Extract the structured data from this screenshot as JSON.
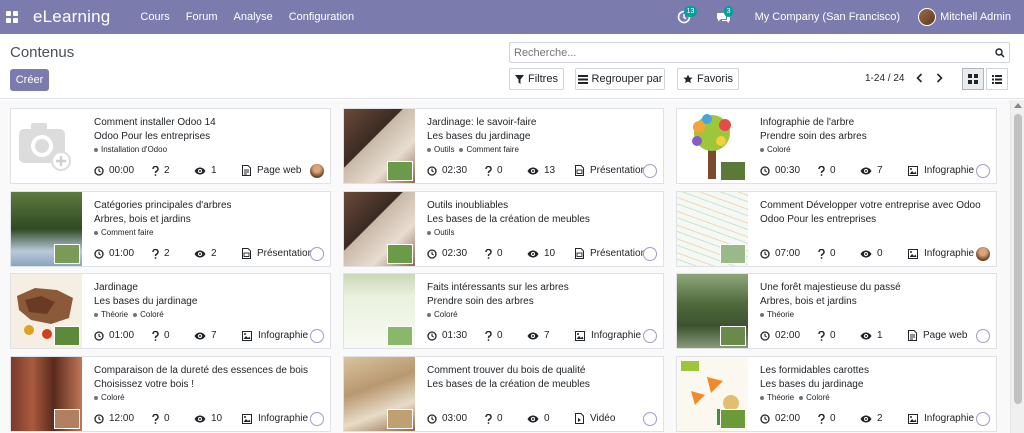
{
  "navbar": {
    "brand": "eLearning",
    "menu": [
      "Cours",
      "Forum",
      "Analyse",
      "Configuration"
    ],
    "activity_count": "13",
    "messages_count": "3",
    "company": "My Company (San Francisco)",
    "user": "Mitchell Admin",
    "color": "#7c7bad"
  },
  "control": {
    "title": "Contenus",
    "create_label": "Créer",
    "search_placeholder": "Recherche...",
    "filters_label": "Filtres",
    "groupby_label": "Regrouper par",
    "favorites_label": "Favoris",
    "pager": "1-24 / 24"
  },
  "cards": [
    {
      "title": "Comment installer Odoo 14",
      "course": "Odoo Pour les entreprises",
      "tags": [
        "Installation d'Odoo"
      ],
      "duration": "00:00",
      "questions": "2",
      "views": "1",
      "type": "Page web",
      "avatar": "photo",
      "thumb": "placeholder"
    },
    {
      "title": "Jardinage: le savoir-faire",
      "course": "Les bases du jardinage",
      "tags": [
        "Outils",
        "Comment faire"
      ],
      "duration": "02:30",
      "questions": "0",
      "views": "13",
      "type": "Présentation",
      "avatar": "empty",
      "thumb": "desk"
    },
    {
      "title": "Infographie de l'arbre",
      "course": "Prendre soin des arbres",
      "tags": [
        "Coloré"
      ],
      "duration": "00:30",
      "questions": "0",
      "views": "7",
      "type": "Infographie",
      "avatar": "empty",
      "thumb": "tree"
    },
    {
      "title": "Catégories principales d'arbres",
      "course": "Arbres, bois et jardins",
      "tags": [
        "Comment faire"
      ],
      "duration": "01:00",
      "questions": "2",
      "views": "2",
      "type": "Présentation",
      "avatar": "empty",
      "thumb": "forest"
    },
    {
      "title": "Outils inoubliables",
      "course": "Les bases de la création de meubles",
      "tags": [
        "Outils"
      ],
      "duration": "02:30",
      "questions": "0",
      "views": "10",
      "type": "Présentation",
      "avatar": "empty",
      "thumb": "desk"
    },
    {
      "title": "Comment Développer votre entreprise avec Odoo",
      "course": "Odoo Pour les entreprises",
      "tags": [],
      "duration": "07:00",
      "questions": "0",
      "views": "0",
      "type": "Infographie",
      "avatar": "photo",
      "thumb": "mindmap"
    },
    {
      "title": "Jardinage",
      "course": "Les bases du jardinage",
      "tags": [
        "Théorie",
        "Coloré"
      ],
      "duration": "01:00",
      "questions": "0",
      "views": "7",
      "type": "Infographie",
      "avatar": "empty",
      "thumb": "map"
    },
    {
      "title": "Faits intéressants sur les arbres",
      "course": "Prendre soin des arbres",
      "tags": [
        "Coloré"
      ],
      "duration": "01:30",
      "questions": "0",
      "views": "7",
      "type": "Infographie",
      "avatar": "empty",
      "thumb": "facts"
    },
    {
      "title": "Une forêt majestieuse du passé",
      "course": "Arbres, bois et jardins",
      "tags": [
        "Théorie"
      ],
      "duration": "02:00",
      "questions": "0",
      "views": "1",
      "type": "Page web",
      "avatar": "empty",
      "thumb": "woods"
    },
    {
      "title": "Comparaison de la dureté des essences de bois",
      "course": "Choisissez votre bois !",
      "tags": [
        "Coloré"
      ],
      "duration": "12:00",
      "questions": "0",
      "views": "10",
      "type": "Infographie",
      "avatar": "empty",
      "thumb": "wood"
    },
    {
      "title": "Comment trouver du bois de qualité",
      "course": "Les bases de la création de meubles",
      "tags": [],
      "duration": "03:00",
      "questions": "0",
      "views": "0",
      "type": "Vidéo",
      "avatar": "empty",
      "thumb": "plank"
    },
    {
      "title": "Les formidables carottes",
      "course": "Les bases du jardinage",
      "tags": [
        "Théorie",
        "Coloré"
      ],
      "duration": "02:00",
      "questions": "0",
      "views": "2",
      "type": "Infographie",
      "avatar": "empty",
      "thumb": "carrots"
    }
  ]
}
